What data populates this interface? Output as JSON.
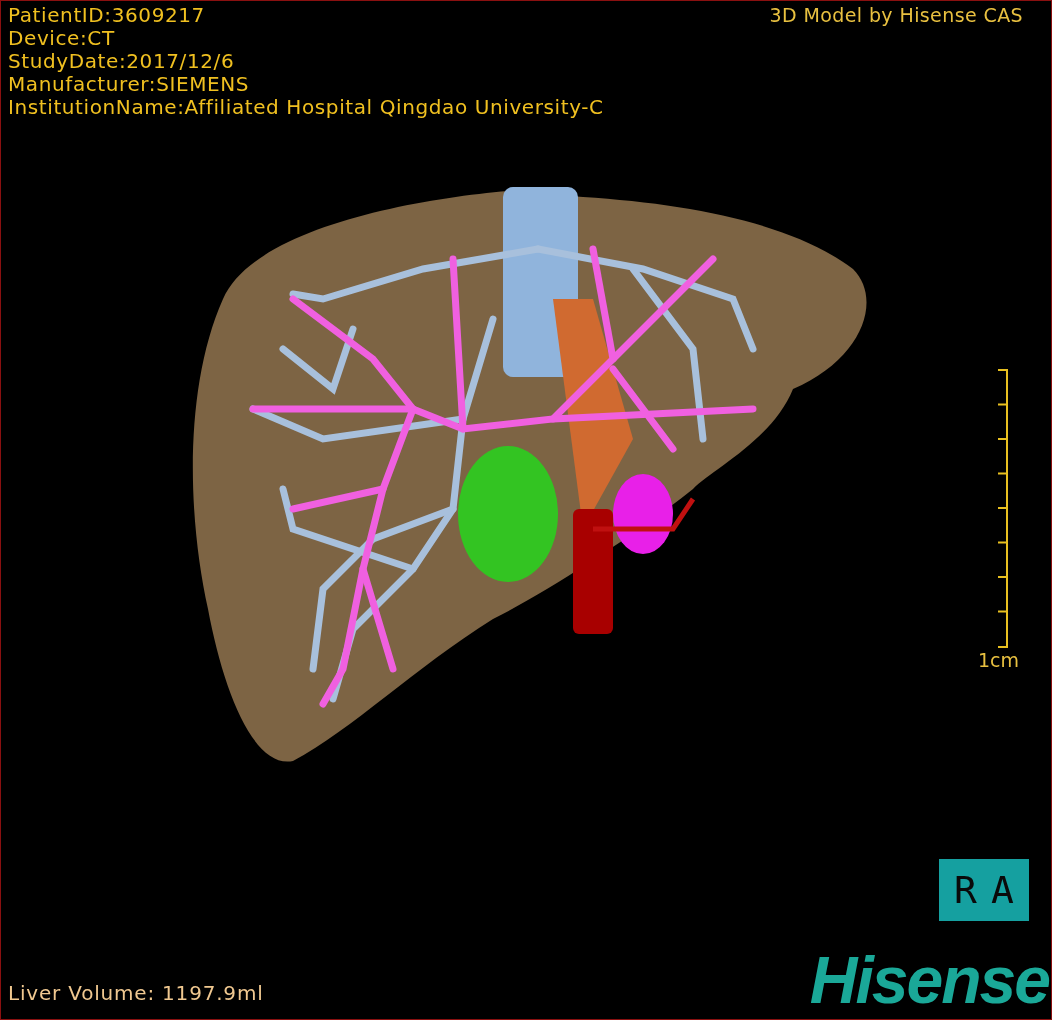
{
  "header": {
    "lines": [
      "PatientID:3609217",
      "Device:CT",
      "StudyDate:2017/12/6",
      "Manufacturer:SIEMENS",
      "InstitutionName:Affiliated Hospital Qingdao University-C"
    ],
    "credit": "3D Model by Hisense CAS"
  },
  "scale_bar": {
    "label": "1cm"
  },
  "orientation": {
    "label": "RA"
  },
  "footer": {
    "volume": "Liver Volume: 1197.9ml",
    "logo": "Hisense"
  }
}
